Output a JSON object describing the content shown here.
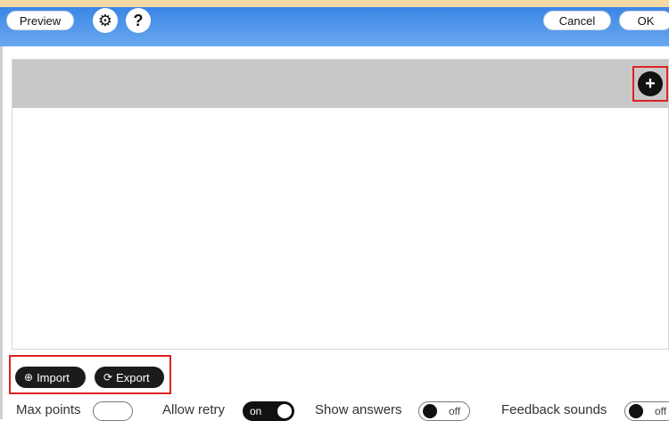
{
  "header": {
    "preview_label": "Preview",
    "cancel_label": "Cancel",
    "ok_label": "OK",
    "settings_icon": "gear-icon",
    "help_icon": "question-icon",
    "help_glyph": "?",
    "gear_glyph": "⚙"
  },
  "panel": {
    "add_icon": "plus-icon",
    "add_glyph": "+"
  },
  "actions": {
    "import_label": "Import",
    "export_label": "Export",
    "import_glyph": "⊕",
    "export_glyph": "⟳"
  },
  "settings": {
    "max_points_label": "Max points",
    "max_points_value": "",
    "allow_retry_label": "Allow retry",
    "allow_retry_state": "on",
    "show_answers_label": "Show answers",
    "show_answers_state": "off",
    "feedback_sounds_label": "Feedback sounds",
    "feedback_sounds_state": "off"
  },
  "colors": {
    "header_blue": "#3a86e6",
    "highlight_red": "#dd2222",
    "top_strip": "#f3d9a3"
  }
}
